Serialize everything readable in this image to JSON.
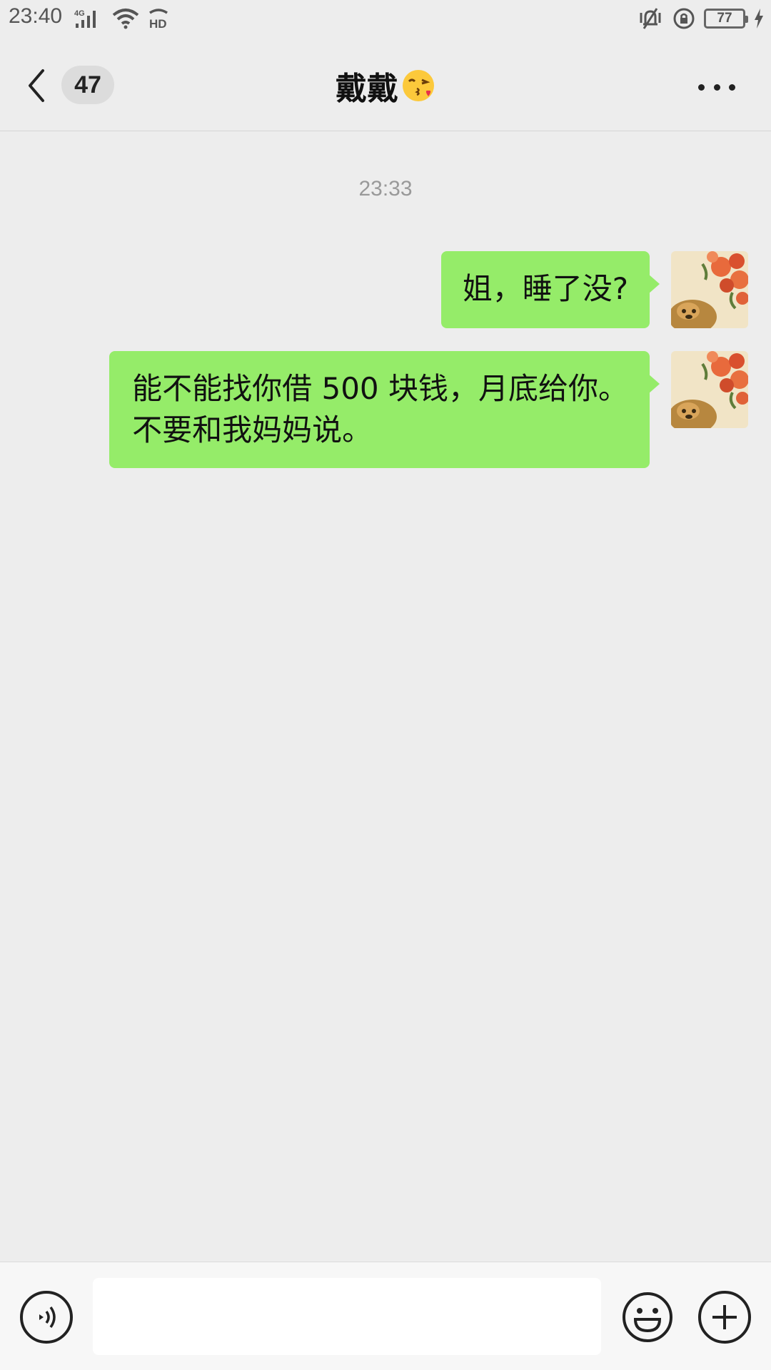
{
  "status_bar": {
    "time": "23:40",
    "network": "4G",
    "hd": "HD",
    "battery": "77",
    "icons": [
      "signal-icon",
      "wifi-icon",
      "hd-call-icon",
      "vibrate-icon",
      "rotation-lock-icon",
      "battery-icon",
      "charging-icon"
    ]
  },
  "header": {
    "unread_count": "47",
    "title": "戴戴",
    "title_emoji": "😘",
    "back_icon": "chevron-left-icon",
    "more_icon": "more-icon"
  },
  "chat": {
    "timestamp": "23:33",
    "messages": [
      {
        "sender": "me",
        "lines": [
          "姐，睡了没?"
        ]
      },
      {
        "sender": "me",
        "lines": [
          "能不能找你借 500 块钱，月底给你。",
          "不要和我妈妈说。"
        ]
      }
    ]
  },
  "input_bar": {
    "placeholder": "",
    "value": "",
    "icons": [
      "voice-icon",
      "emoji-icon",
      "plus-icon"
    ]
  },
  "colors": {
    "background": "#ededed",
    "bubble_green": "#95ec69",
    "text_dark": "#111111",
    "timestamp_gray": "#999999"
  }
}
